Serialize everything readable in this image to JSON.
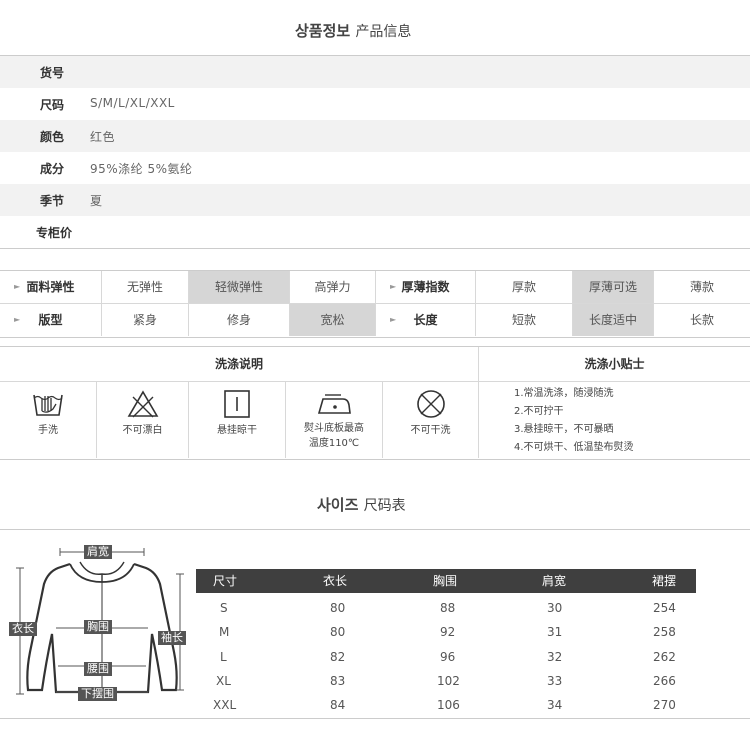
{
  "product_info": {
    "title_kr": "상품정보",
    "title_cn": "产品信息",
    "rows": [
      {
        "key": "货号",
        "value": ""
      },
      {
        "key": "尺码",
        "value": "S/M/L/XL/XXL"
      },
      {
        "key": "颜色",
        "value": "红色"
      },
      {
        "key": "成分",
        "value": "95%涤纶 5%氨纶"
      },
      {
        "key": "季节",
        "value": "夏"
      },
      {
        "key": "专柜价",
        "value": ""
      }
    ]
  },
  "attributes": {
    "row1": {
      "label_a": "面料弹性",
      "options_a": [
        "无弹性",
        "轻微弹性",
        "高弹力"
      ],
      "selected_a": 1,
      "label_b": "厚薄指数",
      "options_b": [
        "厚款",
        "厚薄可选",
        "薄款"
      ],
      "selected_b": 1
    },
    "row2": {
      "label_a": "版型",
      "options_a": [
        "紧身",
        "修身",
        "宽松"
      ],
      "selected_a": 2,
      "label_b": "长度",
      "options_b": [
        "短款",
        "长度适中",
        "长款"
      ],
      "selected_b": 1
    }
  },
  "washing": {
    "title": "洗涤说明",
    "tips_title": "洗涤小贴士",
    "icons": [
      {
        "icon": "hand-wash-icon",
        "label": "手洗"
      },
      {
        "icon": "no-bleach-icon",
        "label": "不可漂白"
      },
      {
        "icon": "hang-dry-icon",
        "label": "悬挂晾干"
      },
      {
        "icon": "iron-icon",
        "label": "熨斗底板最高",
        "label2": "温度110℃"
      },
      {
        "icon": "no-dry-clean-icon",
        "label": "不可干洗"
      }
    ],
    "tips": [
      "1.常温洗涤，随浸随洗",
      "2.不可拧干",
      "3.悬挂晾干，不可暴晒",
      "4.不可烘干、低温垫布熨烫"
    ]
  },
  "size_chart": {
    "title_kr": "사이즈",
    "title_cn": "尺码表",
    "diagram_labels": {
      "shoulder": "肩宽",
      "chest": "胸围",
      "length": "衣长",
      "sleeve": "袖长",
      "waist": "腰围",
      "hem": "下摆围"
    },
    "headers": [
      "尺寸",
      "衣长",
      "胸围",
      "肩宽",
      "裙摆"
    ],
    "rows": [
      [
        "S",
        "80",
        "88",
        "30",
        "254"
      ],
      [
        "M",
        "80",
        "92",
        "31",
        "258"
      ],
      [
        "L",
        "82",
        "96",
        "32",
        "262"
      ],
      [
        "XL",
        "83",
        "102",
        "33",
        "266"
      ],
      [
        "XXL",
        "84",
        "106",
        "34",
        "270"
      ]
    ]
  }
}
